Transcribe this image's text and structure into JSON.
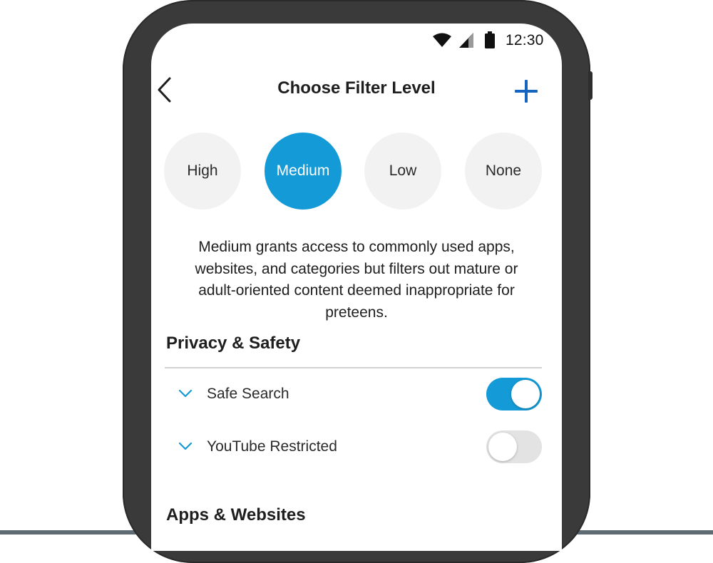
{
  "status_bar": {
    "time": "12:30"
  },
  "header": {
    "title": "Choose Filter Level"
  },
  "filter_levels": [
    {
      "label": "High",
      "selected": false
    },
    {
      "label": "Medium",
      "selected": true
    },
    {
      "label": "Low",
      "selected": false
    },
    {
      "label": "None",
      "selected": false
    }
  ],
  "description": "Medium grants access to commonly used apps, websites, and categories but filters out mature or adult-oriented content deemed inappropriate for preteens.",
  "sections": {
    "privacy": {
      "title": "Privacy & Safety",
      "items": [
        {
          "label": "Safe Search",
          "enabled": true
        },
        {
          "label": "YouTube Restricted",
          "enabled": false
        }
      ]
    },
    "apps": {
      "title": "Apps & Websites"
    }
  },
  "colors": {
    "accent": "#149ad6",
    "add_icon": "#1565c0",
    "frame": "#3a3a3a",
    "unselected_level": "#f2f2f2",
    "toggle_off": "#e3e3e3"
  },
  "icons": [
    "wifi-icon",
    "signal-icon",
    "battery-icon",
    "back-icon",
    "add-icon",
    "chevron-down-icon"
  ]
}
